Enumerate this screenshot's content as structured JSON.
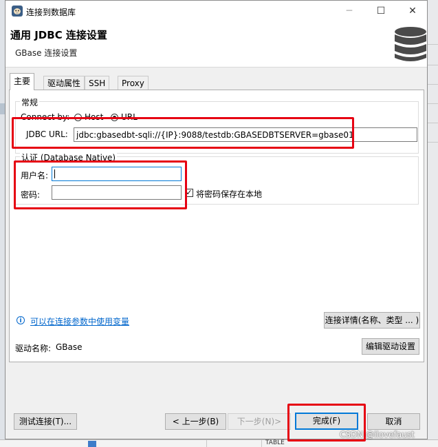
{
  "window": {
    "title": "连接到数据库"
  },
  "header": {
    "title": "通用 JDBC 连接设置",
    "subtitle": "GBase 连接设置",
    "icon": "database-icon"
  },
  "tabs": [
    {
      "label": "主要",
      "active": true
    },
    {
      "label": "驱动属性",
      "active": false
    },
    {
      "label": "SSH",
      "active": false
    },
    {
      "label": "Proxy",
      "active": false
    }
  ],
  "general": {
    "legend": "常规",
    "connect_by_label": "Connect by:",
    "option_host": "Host",
    "option_url": "URL",
    "selected": "URL",
    "jdbc_url_label": "JDBC URL:",
    "jdbc_url_value": "jdbc:gbasedbt-sqli://{IP}:9088/testdb:GBASEDBTSERVER=gbase01"
  },
  "auth": {
    "legend": "认证 (Database Native)",
    "username_label": "用户名:",
    "username_value": "",
    "password_label": "密码:",
    "password_value": "",
    "save_password_label": "将密码保存在本地",
    "save_password_checked": true
  },
  "variables_link": "可以在连接参数中使用变量",
  "details_button": "连接详情(名称、类型 ... )",
  "driver": {
    "label": "驱动名称:",
    "name": "GBase",
    "edit_button": "编辑驱动设置"
  },
  "footer": {
    "test_button": "测试连接(T)...",
    "back_button": "< 上一步(B)",
    "next_button": "下一步(N)>",
    "finish_button": "完成(F)",
    "cancel_button": "取消"
  },
  "background": {
    "cell_text": "TABLE"
  },
  "watermark": "CSDN @ilovefaust",
  "colors": {
    "highlight": "#e60012",
    "accent": "#0078d7",
    "link": "#0066cc"
  }
}
